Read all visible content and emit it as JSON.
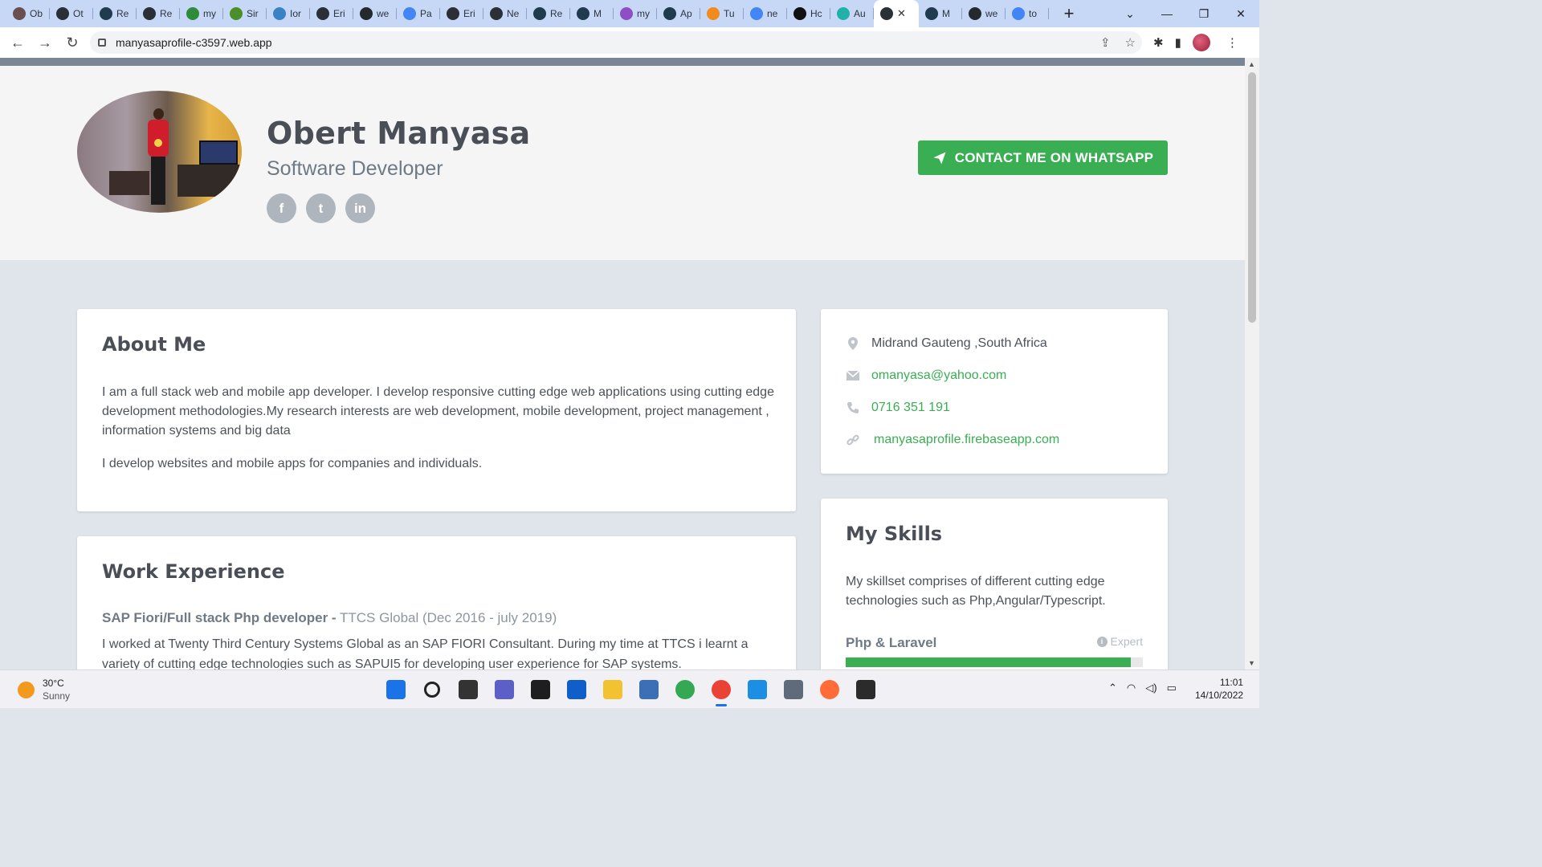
{
  "browser": {
    "tabs": [
      {
        "label": "Ob",
        "color": "#6b4f4f"
      },
      {
        "label": "Ot",
        "color": "#2b2f36"
      },
      {
        "label": "Re",
        "color": "#1f3b4d"
      },
      {
        "label": "Re",
        "color": "#2b2f36"
      },
      {
        "label": "my",
        "color": "#2e8b3a"
      },
      {
        "label": "Sir",
        "color": "#4a8f2a"
      },
      {
        "label": "Ior",
        "color": "#3b82c4"
      },
      {
        "label": "Eri",
        "color": "#2b2f36"
      },
      {
        "label": "we",
        "color": "#24292e"
      },
      {
        "label": "Pa",
        "color": "#4285f4"
      },
      {
        "label": "Eri",
        "color": "#2b2f36"
      },
      {
        "label": "Ne",
        "color": "#2b2f36"
      },
      {
        "label": "Re",
        "color": "#1f3b4d"
      },
      {
        "label": "M",
        "color": "#1f3b4d"
      },
      {
        "label": "my",
        "color": "#8e4fc4"
      },
      {
        "label": "Ap",
        "color": "#1f3b4d"
      },
      {
        "label": "Tu",
        "color": "#f28a1e"
      },
      {
        "label": "ne",
        "color": "#4285f4"
      },
      {
        "label": "Hc",
        "color": "#111111"
      },
      {
        "label": "Au",
        "color": "#20b2aa"
      }
    ],
    "active_tab_color": "#2b2f36",
    "trailing_tabs": [
      {
        "label": "M",
        "color": "#1f3b4d"
      },
      {
        "label": "we",
        "color": "#24292e"
      },
      {
        "label": "to",
        "color": "#4285f4"
      }
    ],
    "url": "manyasaprofile-c3597.web.app"
  },
  "profile": {
    "name": "Obert Manyasa",
    "role": "Software Developer",
    "socials": [
      {
        "icon": "facebook-icon",
        "glyph": "f"
      },
      {
        "icon": "twitter-icon",
        "glyph": "t"
      },
      {
        "icon": "linkedin-icon",
        "glyph": "in"
      }
    ],
    "whatsapp_label": "CONTACT ME ON WHATSAPP"
  },
  "about": {
    "title": "About Me",
    "p1": "I am a full stack web and mobile app developer. I develop responsive cutting edge web applications using cutting edge development methodologies.My research interests are web development, mobile development, project management , information systems and big data",
    "p2": "I develop websites and mobile apps for companies and individuals."
  },
  "work": {
    "title": "Work Experience",
    "job_title": "SAP Fiori/Full stack Php developer -",
    "job_company": "TTCS Global (Dec 2016 - july 2019)",
    "job_desc": "I worked at Twenty Third Century Systems Global as an SAP FIORI Consultant. During my time at TTCS i learnt a variety of cutting edge technologies such as SAPUI5 for developing user experience for SAP systems."
  },
  "contact": {
    "location": "Midrand Gauteng ,South Africa",
    "email": "omanyasa@yahoo.com",
    "phone": "0716 351 191",
    "website": "manyasaprofile.firebaseapp.com"
  },
  "skills": {
    "title": "My Skills",
    "description": "My skillset comprises of different cutting edge technologies such as Php,Angular/Typescript.",
    "items": [
      {
        "name": "Php & Laravel",
        "level": "Expert",
        "value": 0.96
      }
    ]
  },
  "colors": {
    "accent": "#3aae52",
    "heading": "#4a4f57",
    "muted": "#6e7a86",
    "page_bg": "#dfe5ea"
  },
  "taskbar": {
    "temperature": "30°C",
    "condition": "Sunny",
    "time": "11:01",
    "date": "14/10/2022",
    "apps": [
      {
        "name": "start-icon",
        "color": "#1a73e8"
      },
      {
        "name": "search-icon",
        "color": "#222222"
      },
      {
        "name": "task-view-icon",
        "color": "#333333"
      },
      {
        "name": "teams-icon",
        "color": "#5b5fc7"
      },
      {
        "name": "terminal-icon",
        "color": "#1e1e1e"
      },
      {
        "name": "store-icon",
        "color": "#0f5ec9"
      },
      {
        "name": "file-explorer-icon",
        "color": "#f2c231"
      },
      {
        "name": "network-app-icon",
        "color": "#3c6fb5"
      },
      {
        "name": "chrome-icon",
        "color": "#34a853"
      },
      {
        "name": "chrome-profile-icon",
        "color": "#ea4335"
      },
      {
        "name": "vscode-icon",
        "color": "#1c8ee3"
      },
      {
        "name": "settings-icon",
        "color": "#5f6b7a"
      },
      {
        "name": "postman-icon",
        "color": "#ff6c37"
      },
      {
        "name": "cmd-icon",
        "color": "#2b2b2b"
      }
    ]
  }
}
